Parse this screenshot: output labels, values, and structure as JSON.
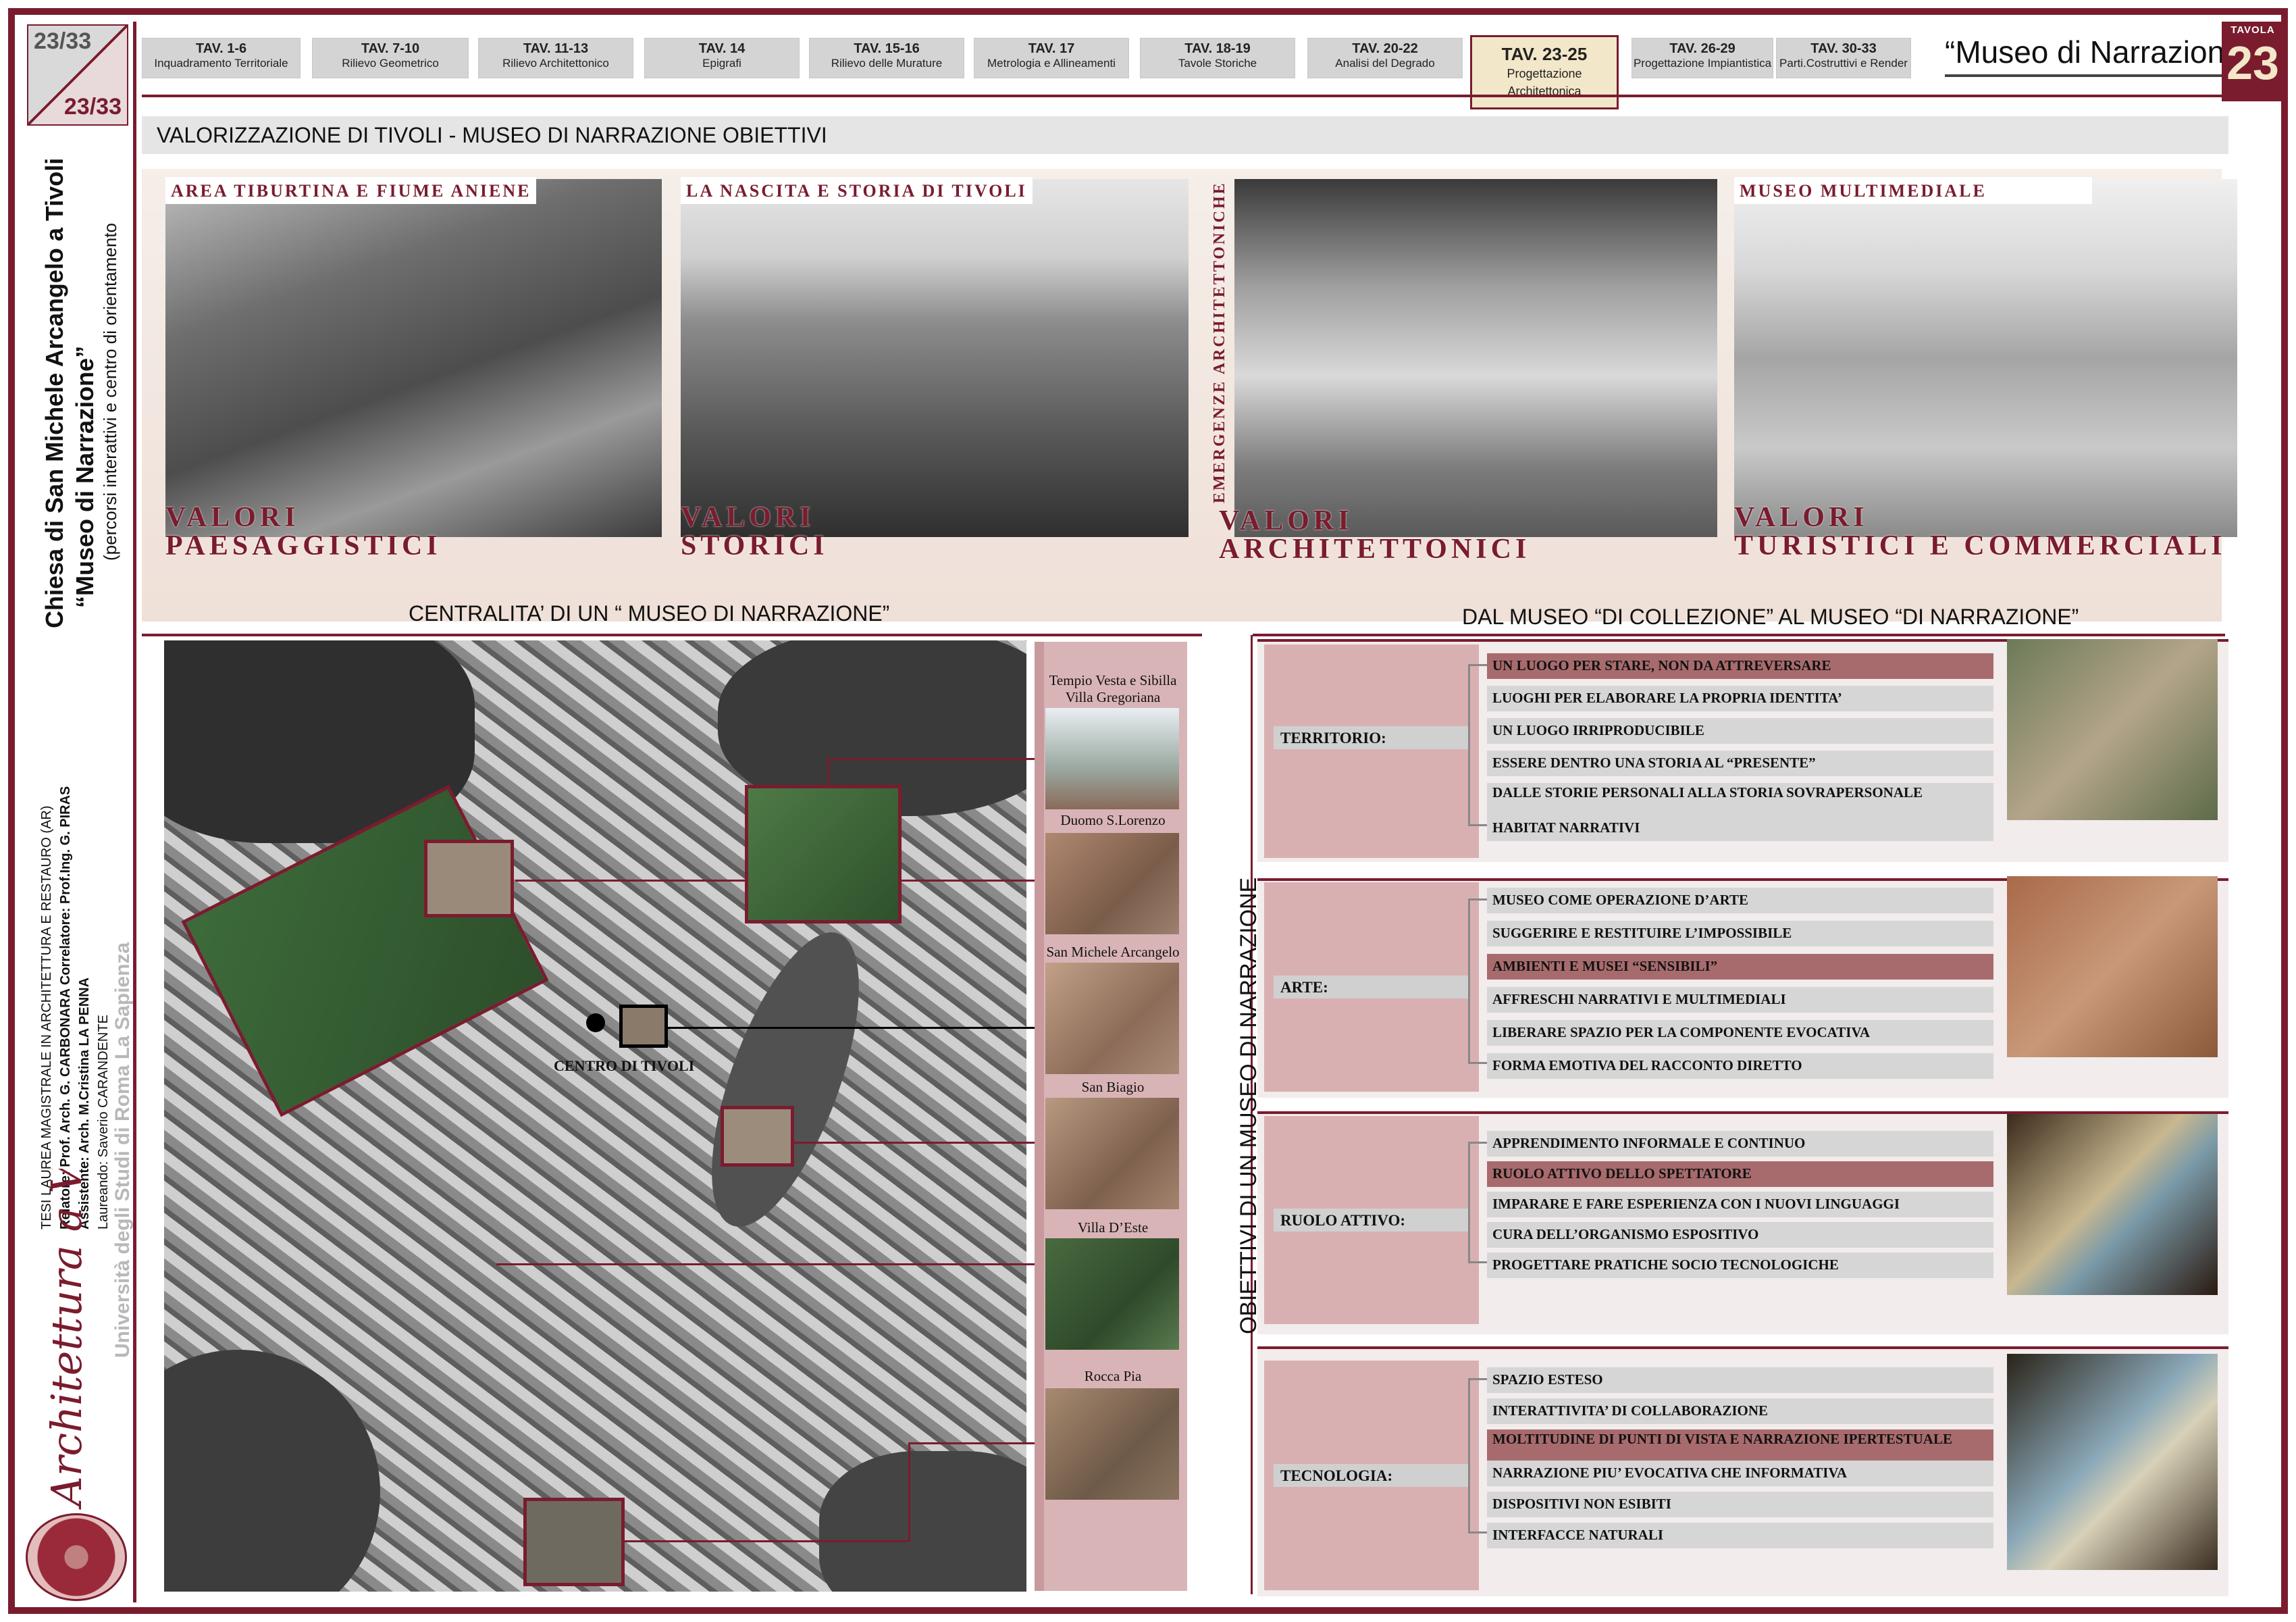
{
  "page": {
    "num": "23",
    "den": "33"
  },
  "tabs": [
    {
      "code": "TAV. 1-6",
      "name": "Inquadramento Territoriale"
    },
    {
      "code": "TAV. 7-10",
      "name": "Rilievo Geometrico"
    },
    {
      "code": "TAV. 11-13",
      "name": "Rilievo Architettonico"
    },
    {
      "code": "TAV. 14",
      "name": "Epigrafi"
    },
    {
      "code": "TAV. 15-16",
      "name": "Rilievo delle Murature"
    },
    {
      "code": "TAV. 17",
      "name": "Metrologia e Allineamenti"
    },
    {
      "code": "TAV. 18-19",
      "name": "Tavole Storiche"
    },
    {
      "code": "TAV. 20-22",
      "name": "Analisi del Degrado"
    },
    {
      "code": "TAV. 23-25",
      "name": "Progettazione Architettonica"
    },
    {
      "code": "TAV. 26-29",
      "name": "Progettazione Impiantistica"
    },
    {
      "code": "TAV. 30-33",
      "name": "Parti.Costruttivi e Render"
    }
  ],
  "header": {
    "title": "“Museo di Narrazione”",
    "tavola_label": "TAVOLA",
    "tavola_num": "23"
  },
  "sidebar": {
    "title": "Chiesa di San Michele Arcangelo a Tivoli",
    "subtitle": "“Museo di Narrazione”",
    "subtitle2": "(percorsi interattivi e centro di orientamento",
    "thesis": "TESI LAUREA MAGISTRALE IN ARCHITETTURA E RESTAURO (AR)",
    "relatore": "Relatore: Prof. Arch. G. CARBONARA  Correlatore: Prof.Ing. G. PIRAS",
    "assistente": "Assistente: Arch. M.Cristina LA PENNA",
    "laureando": "Laureando: Saverio CARANDENTE",
    "logo_text": "Architettura a Valle Giulia",
    "university": "Università degli Studi di Roma La Sapienza"
  },
  "banner": "VALORIZZAZIONE DI TIVOLI - MUSEO DI NARRAZIONE OBIETTIVI",
  "photos": [
    {
      "label": "AREA TIBURTINA E FIUME ANIENE",
      "v1": "VALORI",
      "v2": "PAESAGGISTICI"
    },
    {
      "label": "LA NASCITA  E STORIA DI TIVOLI",
      "v1": "VALORI",
      "v2": "STORICI"
    },
    {
      "label": "EMERGENZE ARCHITETTONICHE",
      "v1": "VALORI",
      "v2": "ARCHITETTONICI"
    },
    {
      "label": "MUSEO MULTIMEDIALE",
      "v1": "VALORI",
      "v2": "TURISTICI E COMMERCIALI"
    }
  ],
  "sections": {
    "left": "CENTRALITA’ DI UN “ MUSEO DI NARRAZIONE”",
    "right": "DAL MUSEO “DI COLLEZIONE” AL MUSEO “DI NARRAZIONE”",
    "vertical": "OBIETTIVI DI UN MUSEO DI NARRAZIONE"
  },
  "map": {
    "centro": "CENTRO DI TIVOLI"
  },
  "refs": [
    {
      "label": "Tempio Vesta e Sibilla\nVilla Gregoriana"
    },
    {
      "label": "Duomo S.Lorenzo"
    },
    {
      "label": "San Michele Arcangelo"
    },
    {
      "label": "San Biagio"
    },
    {
      "label": "Villa D’Este"
    },
    {
      "label": "Rocca Pia"
    }
  ],
  "groups": [
    {
      "cat": "TERRITORIO:",
      "items": [
        {
          "t": "UN LUOGO PER STARE, NON DA ATTREVERSARE",
          "hl": true
        },
        {
          "t": "LUOGHI PER ELABORARE LA PROPRIA IDENTITA’",
          "hl": false
        },
        {
          "t": "UN LUOGO IRRIPRODUCIBILE",
          "hl": false
        },
        {
          "t": "ESSERE DENTRO UNA STORIA AL “PRESENTE”",
          "hl": false
        },
        {
          "t": "DALLE STORIE PERSONALI ALLA STORIA SOVRAPERSONALE",
          "hl": false
        },
        {
          "t": "HABITAT NARRATIVI",
          "hl": false
        }
      ]
    },
    {
      "cat": "ARTE:",
      "items": [
        {
          "t": "MUSEO COME OPERAZIONE D’ARTE",
          "hl": false
        },
        {
          "t": "SUGGERIRE E RESTITUIRE L’IMPOSSIBILE",
          "hl": false
        },
        {
          "t": "AMBIENTI E MUSEI “SENSIBILI”",
          "hl": true
        },
        {
          "t": "AFFRESCHI NARRATIVI E MULTIMEDIALI",
          "hl": false
        },
        {
          "t": "LIBERARE SPAZIO PER LA COMPONENTE EVOCATIVA",
          "hl": false
        },
        {
          "t": "FORMA EMOTIVA DEL RACCONTO DIRETTO",
          "hl": false
        }
      ]
    },
    {
      "cat": "RUOLO ATTIVO:",
      "items": [
        {
          "t": "APPRENDIMENTO INFORMALE E CONTINUO",
          "hl": false
        },
        {
          "t": "RUOLO ATTIVO DELLO SPETTATORE",
          "hl": true
        },
        {
          "t": "IMPARARE E FARE ESPERIENZA CON I NUOVI LINGUAGGI",
          "hl": false
        },
        {
          "t": "CURA DELL’ORGANISMO ESPOSITIVO",
          "hl": false
        },
        {
          "t": "PROGETTARE PRATICHE SOCIO TECNOLOGICHE",
          "hl": false
        }
      ]
    },
    {
      "cat": "TECNOLOGIA:",
      "items": [
        {
          "t": "SPAZIO ESTESO",
          "hl": false
        },
        {
          "t": "INTERATTIVITA’ DI COLLABORAZIONE",
          "hl": false
        },
        {
          "t": "MOLTITUDINE DI PUNTI DI VISTA E NARRAZIONE IPERTESTUALE",
          "hl": true
        },
        {
          "t": "NARRAZIONE PIU’ EVOCATIVA CHE INFORMATIVA",
          "hl": false
        },
        {
          "t": "DISPOSITIVI NON ESIBITI",
          "hl": false
        },
        {
          "t": "INTERFACCE NATURALI",
          "hl": false
        }
      ]
    }
  ]
}
